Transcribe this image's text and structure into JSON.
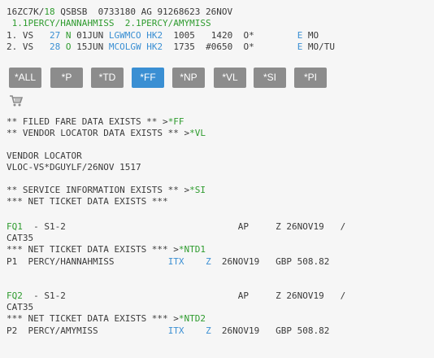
{
  "pnr": {
    "line1": {
      "pre": "16ZC7K/",
      "agent": "18",
      "post": " QSBSB  0733180 AG 91268623 26NOV"
    },
    "names_line": " 1.1PERCY/HANNAHMISS  2.1PERCY/AMYMISS",
    "seg1": {
      "a": "1. VS   ",
      "fl": "27",
      "cls": " N ",
      "date": "01JUN ",
      "route": "LGWMCO",
      "st": " HK2",
      "rest": "  1005   1420  O*        ",
      "e": "E",
      "days": " MO"
    },
    "seg2": {
      "a": "2. VS   ",
      "fl": "28",
      "cls": " O ",
      "date": "15JUN ",
      "route": "MCOLGW",
      "st": " HK2",
      "rest": "  1735  #0650  O*        ",
      "e": "E",
      "days": " MO/TU"
    }
  },
  "tabs": [
    "*ALL",
    "*P",
    "*TD",
    "*FF",
    "*NP",
    "*VL",
    "*SI",
    "*PI"
  ],
  "active_tab": "*FF",
  "cart_icon": "shopping-cart-icon",
  "body": {
    "filed_fare": {
      "text": "** FILED FARE DATA EXISTS ** >",
      "link": "*FF"
    },
    "vendor_loc": {
      "text": "** VENDOR LOCATOR DATA EXISTS ** >",
      "link": "*VL"
    },
    "vl_header": "VENDOR LOCATOR",
    "vl_line": "VLOC-VS*DGUYLF/26NOV 1517",
    "service_info": {
      "text": "** SERVICE INFORMATION EXISTS ** >",
      "link": "*SI"
    },
    "net_ticket": "*** NET TICKET DATA EXISTS ***"
  },
  "fq1": {
    "id": "FQ1",
    "head": "  - S1-2                                AP     Z 26NOV19   /",
    "cat": "CAT35",
    "net_text": "*** NET TICKET DATA EXISTS *** >",
    "net_link": "*NTD1",
    "pax": "P1  PERCY/HANNAHMISS          ",
    "itx": "ITX",
    "z": "Z",
    "tail": "  26NOV19   GBP 508.82"
  },
  "fq2": {
    "id": "FQ2",
    "head": "  - S1-2                                AP     Z 26NOV19   /",
    "cat": "CAT35",
    "net_text": "*** NET TICKET DATA EXISTS *** >",
    "net_link": "*NTD2",
    "pax": "P2  PERCY/AMYMISS             ",
    "itx": "ITX",
    "z": "Z",
    "tail": "  26NOV19   GBP 508.82"
  }
}
